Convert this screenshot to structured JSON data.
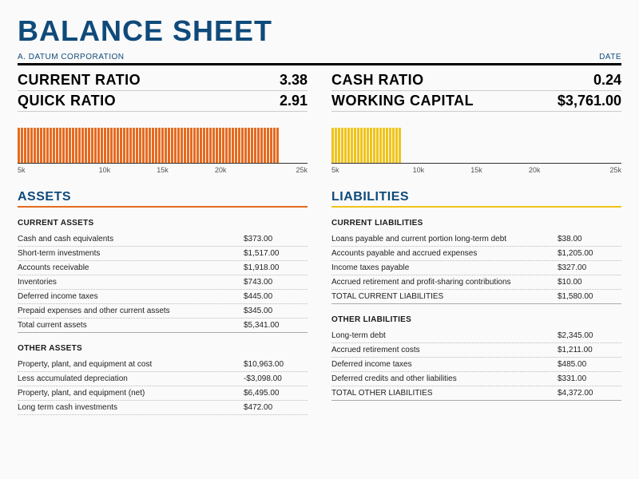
{
  "title": "BALANCE SHEET",
  "company": "A. DATUM CORPORATION",
  "date_label": "DATE",
  "ratios": {
    "left": [
      {
        "label": "CURRENT RATIO",
        "value": "3.38"
      },
      {
        "label": "QUICK RATIO",
        "value": "2.91"
      }
    ],
    "right": [
      {
        "label": "CASH RATIO",
        "value": "0.24"
      },
      {
        "label": "WORKING CAPITAL",
        "value": "$3,761.00"
      }
    ]
  },
  "axis_ticks": [
    "5k",
    "10k",
    "15k",
    "20k",
    "25k"
  ],
  "assets": {
    "title": "ASSETS",
    "current": {
      "title": "CURRENT ASSETS",
      "items": [
        {
          "label": "Cash and cash equivalents",
          "value": "$373.00"
        },
        {
          "label": "Short-term investments",
          "value": "$1,517.00"
        },
        {
          "label": "Accounts receivable",
          "value": "$1,918.00"
        },
        {
          "label": "Inventories",
          "value": "$743.00"
        },
        {
          "label": "Deferred income taxes",
          "value": "$445.00"
        },
        {
          "label": "Prepaid expenses and other current assets",
          "value": "$345.00"
        }
      ],
      "total": {
        "label": "Total current assets",
        "value": "$5,341.00"
      }
    },
    "other": {
      "title": "OTHER ASSETS",
      "items": [
        {
          "label": "Property, plant, and equipment at cost",
          "value": "$10,963.00"
        },
        {
          "label": "Less accumulated depreciation",
          "value": "-$3,098.00"
        },
        {
          "label": "Property, plant, and equipment (net)",
          "value": "$6,495.00"
        },
        {
          "label": "Long term cash investments",
          "value": "$472.00"
        }
      ]
    }
  },
  "liabilities": {
    "title": "LIABILITIES",
    "current": {
      "title": "CURRENT LIABILITIES",
      "items": [
        {
          "label": "Loans payable and current portion long-term debt",
          "value": "$38.00"
        },
        {
          "label": "Accounts payable and accrued expenses",
          "value": "$1,205.00"
        },
        {
          "label": "Income taxes payable",
          "value": "$327.00"
        },
        {
          "label": "Accrued retirement and profit-sharing contributions",
          "value": "$10.00"
        }
      ],
      "total": {
        "label": "TOTAL CURRENT LIABILITIES",
        "value": "$1,580.00"
      }
    },
    "other": {
      "title": "OTHER LIABILITIES",
      "items": [
        {
          "label": "Long-term debt",
          "value": "$2,345.00"
        },
        {
          "label": "Accrued retirement costs",
          "value": "$1,211.00"
        },
        {
          "label": "Deferred income taxes",
          "value": "$485.00"
        },
        {
          "label": "Deferred credits and other liabilities",
          "value": "$331.00"
        }
      ],
      "total": {
        "label": "TOTAL OTHER LIABILITIES",
        "value": "$4,372.00"
      }
    }
  },
  "chart_data": [
    {
      "type": "bar",
      "title": "",
      "color": "#e56b1f",
      "approx_value": 22500,
      "xlim": [
        0,
        25000
      ],
      "ticks": [
        5000,
        10000,
        15000,
        20000,
        25000
      ],
      "xlabel": "",
      "ylabel": ""
    },
    {
      "type": "bar",
      "title": "",
      "color": "#f0c419",
      "approx_value": 6000,
      "xlim": [
        0,
        25000
      ],
      "ticks": [
        5000,
        10000,
        15000,
        20000,
        25000
      ],
      "xlabel": "",
      "ylabel": ""
    }
  ]
}
